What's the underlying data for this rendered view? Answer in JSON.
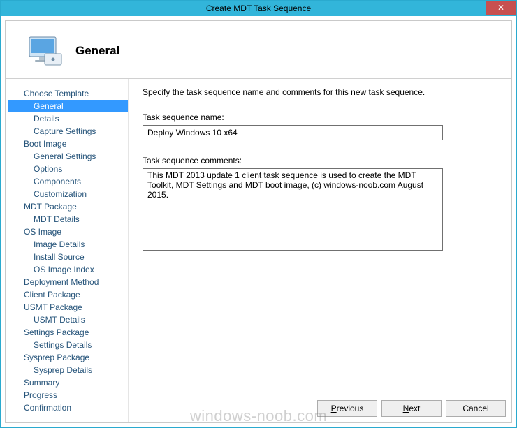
{
  "window": {
    "title": "Create MDT Task Sequence",
    "close_glyph": "✕"
  },
  "header": {
    "title": "General"
  },
  "sidebar": {
    "items": [
      {
        "label": "Choose Template",
        "level": "top"
      },
      {
        "label": "General",
        "level": "sub",
        "selected": true
      },
      {
        "label": "Details",
        "level": "sub"
      },
      {
        "label": "Capture Settings",
        "level": "sub"
      },
      {
        "label": "Boot Image",
        "level": "top"
      },
      {
        "label": "General Settings",
        "level": "sub"
      },
      {
        "label": "Options",
        "level": "sub"
      },
      {
        "label": "Components",
        "level": "sub"
      },
      {
        "label": "Customization",
        "level": "sub"
      },
      {
        "label": "MDT Package",
        "level": "top"
      },
      {
        "label": "MDT Details",
        "level": "sub"
      },
      {
        "label": "OS Image",
        "level": "top"
      },
      {
        "label": "Image Details",
        "level": "sub"
      },
      {
        "label": "Install Source",
        "level": "sub"
      },
      {
        "label": "OS Image Index",
        "level": "sub"
      },
      {
        "label": "Deployment Method",
        "level": "top"
      },
      {
        "label": "Client Package",
        "level": "top"
      },
      {
        "label": "USMT Package",
        "level": "top"
      },
      {
        "label": "USMT Details",
        "level": "sub"
      },
      {
        "label": "Settings Package",
        "level": "top"
      },
      {
        "label": "Settings Details",
        "level": "sub"
      },
      {
        "label": "Sysprep Package",
        "level": "top"
      },
      {
        "label": "Sysprep Details",
        "level": "sub"
      },
      {
        "label": "Summary",
        "level": "top"
      },
      {
        "label": "Progress",
        "level": "top"
      },
      {
        "label": "Confirmation",
        "level": "top"
      }
    ]
  },
  "content": {
    "instruction": "Specify the task sequence name and comments for this new task sequence.",
    "name_label": "Task sequence name:",
    "name_value": "Deploy Windows 10 x64",
    "comments_label": "Task sequence comments:",
    "comments_value": "This MDT 2013 update 1 client task sequence is used to create the MDT Toolkit, MDT Settings and MDT boot image, (c) windows-noob.com August 2015."
  },
  "buttons": {
    "previous": "Previous",
    "next": "Next",
    "cancel": "Cancel"
  },
  "watermark": "windows-noob.com"
}
